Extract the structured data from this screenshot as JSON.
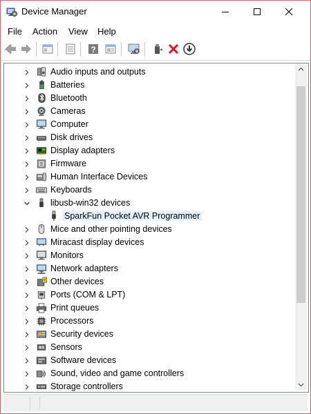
{
  "window": {
    "title": "Device Manager",
    "app_icon": "device-manager-icon"
  },
  "menu": {
    "file": "File",
    "action": "Action",
    "view": "View",
    "help": "Help"
  },
  "toolbar": {
    "buttons": [
      "back-arrow-icon",
      "forward-arrow-icon",
      "properties-icon",
      "show-hidden-icon",
      "help-icon",
      "details-icon",
      "scan-hardware-icon",
      "update-driver-icon",
      "uninstall-icon",
      "download-icon"
    ],
    "uninstall_color": "#e81123"
  },
  "tree": {
    "items": [
      {
        "label": "Audio inputs and outputs",
        "icon": "speaker-icon",
        "expanded": false
      },
      {
        "label": "Batteries",
        "icon": "battery-icon",
        "expanded": false
      },
      {
        "label": "Bluetooth",
        "icon": "bluetooth-icon",
        "expanded": false
      },
      {
        "label": "Cameras",
        "icon": "camera-icon",
        "expanded": false
      },
      {
        "label": "Computer",
        "icon": "computer-icon",
        "expanded": false
      },
      {
        "label": "Disk drives",
        "icon": "disk-drive-icon",
        "expanded": false
      },
      {
        "label": "Display adapters",
        "icon": "display-adapter-icon",
        "expanded": false
      },
      {
        "label": "Firmware",
        "icon": "firmware-icon",
        "expanded": false
      },
      {
        "label": "Human Interface Devices",
        "icon": "hid-icon",
        "expanded": false
      },
      {
        "label": "Keyboards",
        "icon": "keyboard-icon",
        "expanded": false
      },
      {
        "label": "libusb-win32 devices",
        "icon": "usb-device-icon",
        "expanded": true
      },
      {
        "label": "SparkFun Pocket AVR Programmer",
        "icon": "usb-plug-icon",
        "child": true
      },
      {
        "label": "Mice and other pointing devices",
        "icon": "mouse-icon",
        "expanded": false
      },
      {
        "label": "Miracast display devices",
        "icon": "miracast-icon",
        "expanded": false
      },
      {
        "label": "Monitors",
        "icon": "monitor-icon",
        "expanded": false
      },
      {
        "label": "Network adapters",
        "icon": "network-adapter-icon",
        "expanded": false
      },
      {
        "label": "Other devices",
        "icon": "other-devices-icon",
        "expanded": false
      },
      {
        "label": "Ports (COM & LPT)",
        "icon": "port-icon",
        "expanded": false
      },
      {
        "label": "Print queues",
        "icon": "printer-icon",
        "expanded": false
      },
      {
        "label": "Processors",
        "icon": "processor-icon",
        "expanded": false
      },
      {
        "label": "Security devices",
        "icon": "security-device-icon",
        "expanded": false
      },
      {
        "label": "Sensors",
        "icon": "sensor-icon",
        "expanded": false
      },
      {
        "label": "Software devices",
        "icon": "software-device-icon",
        "expanded": false
      },
      {
        "label": "Sound, video and game controllers",
        "icon": "sound-controller-icon",
        "expanded": false
      },
      {
        "label": "Storage controllers",
        "icon": "storage-controller-icon",
        "expanded": false
      }
    ]
  }
}
